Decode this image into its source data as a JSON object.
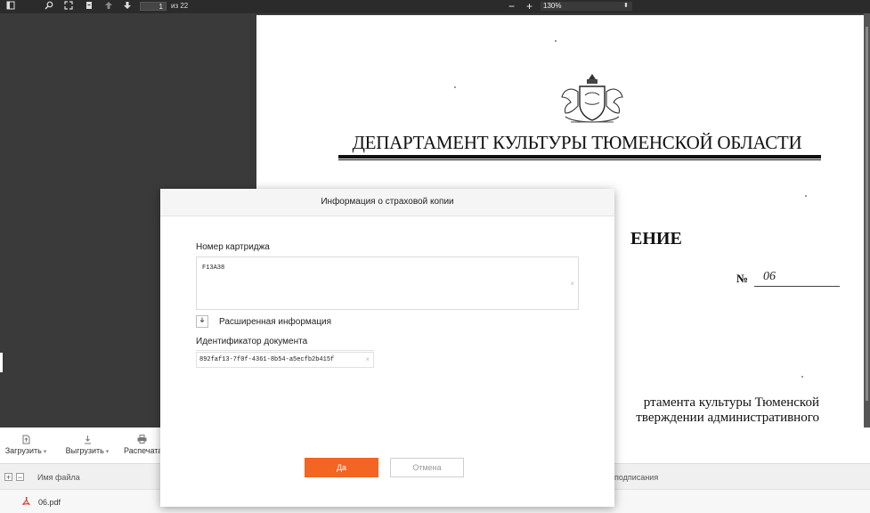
{
  "pdf_toolbar": {
    "icons": [
      "sidebar-icon",
      "search-icon",
      "fullscreen-icon",
      "page-icon",
      "arrow-up-icon",
      "arrow-down-icon"
    ],
    "page_current": "1",
    "page_total": "из 22",
    "zoom_minus": "−",
    "zoom_plus": "+",
    "zoom_value": "130%"
  },
  "document": {
    "department_title": "ДЕПАРТАМЕНТ КУЛЬТУРЫ ТЮМЕНСКОЙ ОБЛАСТИ",
    "doc_type_partial": "ЕНИЕ",
    "number_label": "№",
    "number_value": "06",
    "body_line_1": "ртамента культуры Тюменской",
    "body_line_2": "тверждении административного"
  },
  "bottom_toolbar": {
    "upload": "Загрузить",
    "download": "Выгрузить",
    "print": "Распечата"
  },
  "table": {
    "col_filename": "Имя файла",
    "col_signing": "подписания",
    "rows": [
      {
        "name": "06.pdf"
      }
    ]
  },
  "modal": {
    "title": "Информация о страховой копии",
    "cartridge_label": "Номер картриджа",
    "cartridge_value": "F13A38",
    "extended_info": "Расширенная информация",
    "docid_label": "Идентификатор документа",
    "docid_value": "892faf13-7f0f-4361-8b54-a5ecfb2b415f",
    "yes": "Да",
    "cancel": "Отмена"
  },
  "colors": {
    "accent": "#f26522",
    "toolbar_bg": "#2b2b2b",
    "viewer_bg": "#3a3a3a"
  }
}
